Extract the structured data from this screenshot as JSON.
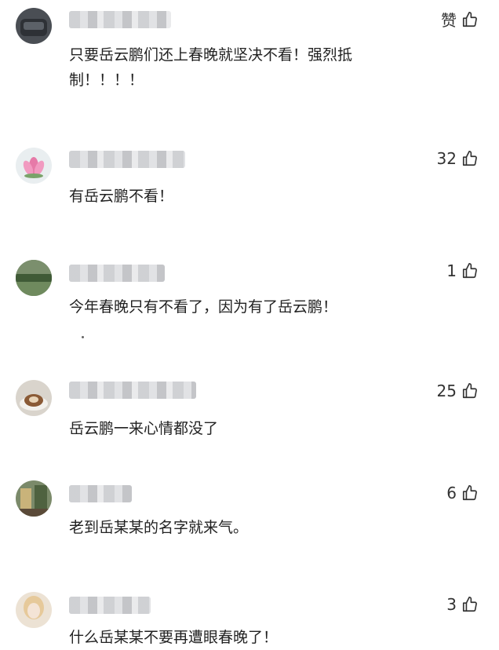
{
  "comments": [
    {
      "text": "只要岳云鹏们还上春晚就坚决不看！强烈抵制！！！！",
      "likes": "赞",
      "avatar": "dark-bag"
    },
    {
      "text": "有岳云鹏不看！",
      "likes": "32",
      "avatar": "lotus-flower"
    },
    {
      "text": "今年春晚只有不看了，因为有了岳云鹏！",
      "likes": "1",
      "avatar": "green-field"
    },
    {
      "text": "岳云鹏一来心情都没了",
      "likes": "25",
      "avatar": "coffee-cup"
    },
    {
      "text": "老到岳某某的名字就来气。",
      "likes": "6",
      "avatar": "garden"
    },
    {
      "text": "什么岳某某不要再遭眼春晚了！",
      "likes": "3",
      "avatar": "blonde-portrait"
    }
  ],
  "colors": {
    "text": "#222222",
    "like_text": "#333333",
    "background": "#ffffff"
  },
  "icons": {
    "like": "thumbs-up-outline-icon"
  }
}
